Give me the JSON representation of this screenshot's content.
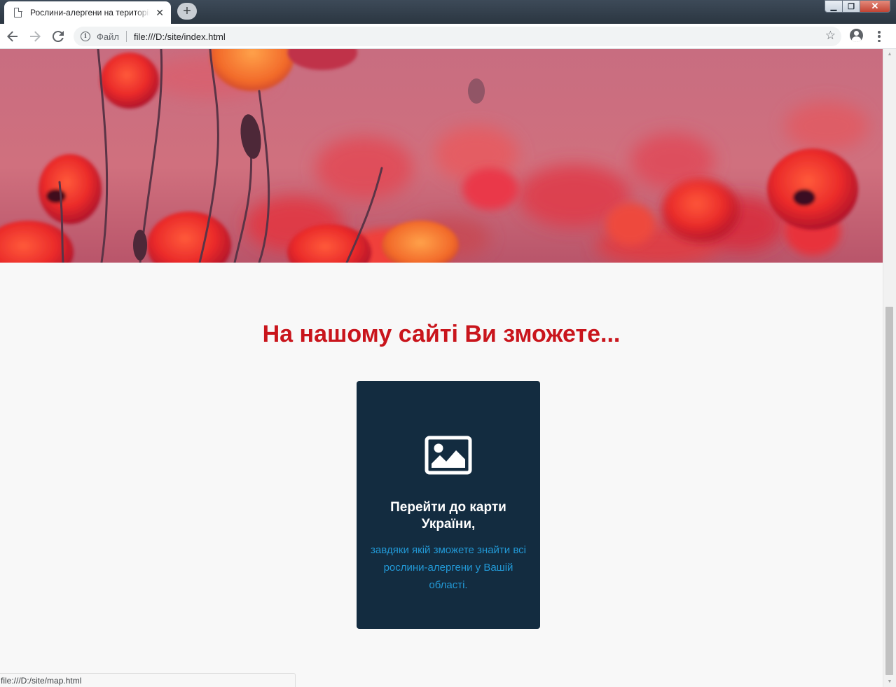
{
  "browser": {
    "tab_title": "Рослини-алергени на території України",
    "tab_close": "✕",
    "new_tab": "+",
    "scheme_label": "Файл",
    "url": "file:///D:/site/index.html",
    "icons": {
      "back": "arrow-left-icon",
      "forward": "arrow-right-icon",
      "reload": "reload-icon",
      "info": "info-icon",
      "bookmark": "star-icon",
      "account": "account-icon",
      "menu": "kebab-menu-icon"
    },
    "window_buttons": {
      "minimize": "▁",
      "restore": "❐",
      "close": "✕"
    }
  },
  "page": {
    "heading": "На нашому сайті Ви зможете...",
    "card": {
      "icon": "image-icon",
      "title": "Перейти до карти України,",
      "text": "завдяки якій зможете знайти всі рослини-алергени у Вашій області."
    }
  },
  "status_bar": {
    "text": "file:///D:/site/map.html"
  },
  "colors": {
    "heading": "#c9151c",
    "card_background": "#132c40",
    "card_text": "#2299d6",
    "page_background": "#f8f8f8"
  }
}
